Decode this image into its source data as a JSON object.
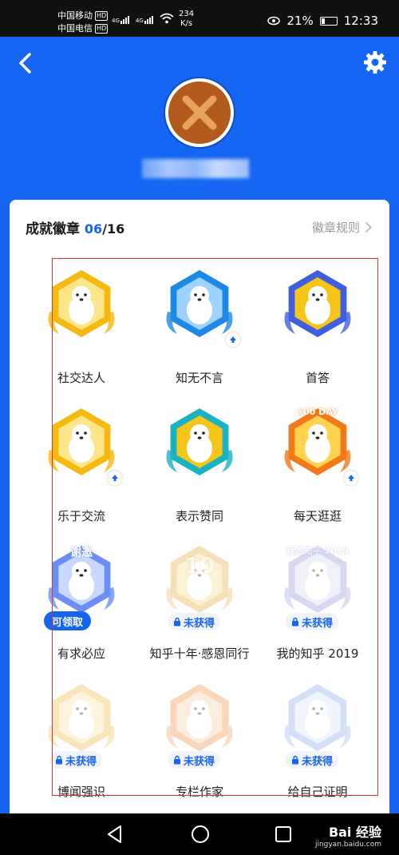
{
  "status_bar": {
    "carrier1": "中国移动",
    "carrier2": "中国电信",
    "hd": "HD",
    "net1": "4G",
    "net2": "4G",
    "speed_value": "234",
    "speed_unit": "K/s",
    "battery": "21%",
    "time": "12:33"
  },
  "header": {
    "back_icon": "back-arrow-icon",
    "settings_icon": "gear-icon"
  },
  "card": {
    "title": "成就徽章",
    "count": "06",
    "total": "/16",
    "rules_label": "徽章规则"
  },
  "badges": [
    {
      "label": "社交达人",
      "status": "earned",
      "colors": [
        "#f5b90f",
        "#fde68a"
      ]
    },
    {
      "label": "知无不言",
      "status": "earned",
      "upgrade": true,
      "colors": [
        "#1e88e5",
        "#9fd3ff"
      ]
    },
    {
      "label": "首答",
      "status": "earned",
      "colors": [
        "#3f5fe0",
        "#f5c518"
      ]
    },
    {
      "label": "乐于交流",
      "status": "earned",
      "upgrade": true,
      "colors": [
        "#f5b90f",
        "#fde68a"
      ]
    },
    {
      "label": "表示赞同",
      "status": "earned",
      "colors": [
        "#17b3c2",
        "#f5c518"
      ]
    },
    {
      "label": "每天逛逛",
      "status": "earned",
      "upgrade": true,
      "badge_text": "100 DAY",
      "colors": [
        "#f07a1a",
        "#ffd34d"
      ]
    },
    {
      "label": "有求必应",
      "status": "claimable",
      "pill": "可领取",
      "badge_text": "谢邀",
      "colors": [
        "#6c8ef5",
        "#c9d8ff"
      ]
    },
    {
      "label": "知乎十年·感恩同行",
      "status": "locked",
      "pill": "未获得",
      "badge_text": "10",
      "colors": [
        "#e9a93a",
        "#f7d98a"
      ]
    },
    {
      "label": "我的知乎 2019",
      "status": "locked",
      "pill": "未获得",
      "badge_text": "我的知乎 2019",
      "colors": [
        "#8e8ed8",
        "#d6d6f5"
      ]
    },
    {
      "label": "博闻强识",
      "status": "locked",
      "pill": "未获得",
      "colors": [
        "#f2b43a",
        "#fbe2a0"
      ]
    },
    {
      "label": "专栏作家",
      "status": "locked",
      "pill": "未获得",
      "colors": [
        "#f08a3c",
        "#f9c9a0"
      ]
    },
    {
      "label": "给自己证明",
      "status": "locked",
      "pill": "未获得",
      "colors": [
        "#7fa4e8",
        "#d3e1fb"
      ]
    }
  ],
  "nav": {
    "back_icon": "triangle-back-icon",
    "home_icon": "circle-home-icon",
    "recent_icon": "square-recent-icon"
  },
  "watermark": {
    "text": "Bai 经验",
    "sub": "jingyan.baidu.com"
  }
}
